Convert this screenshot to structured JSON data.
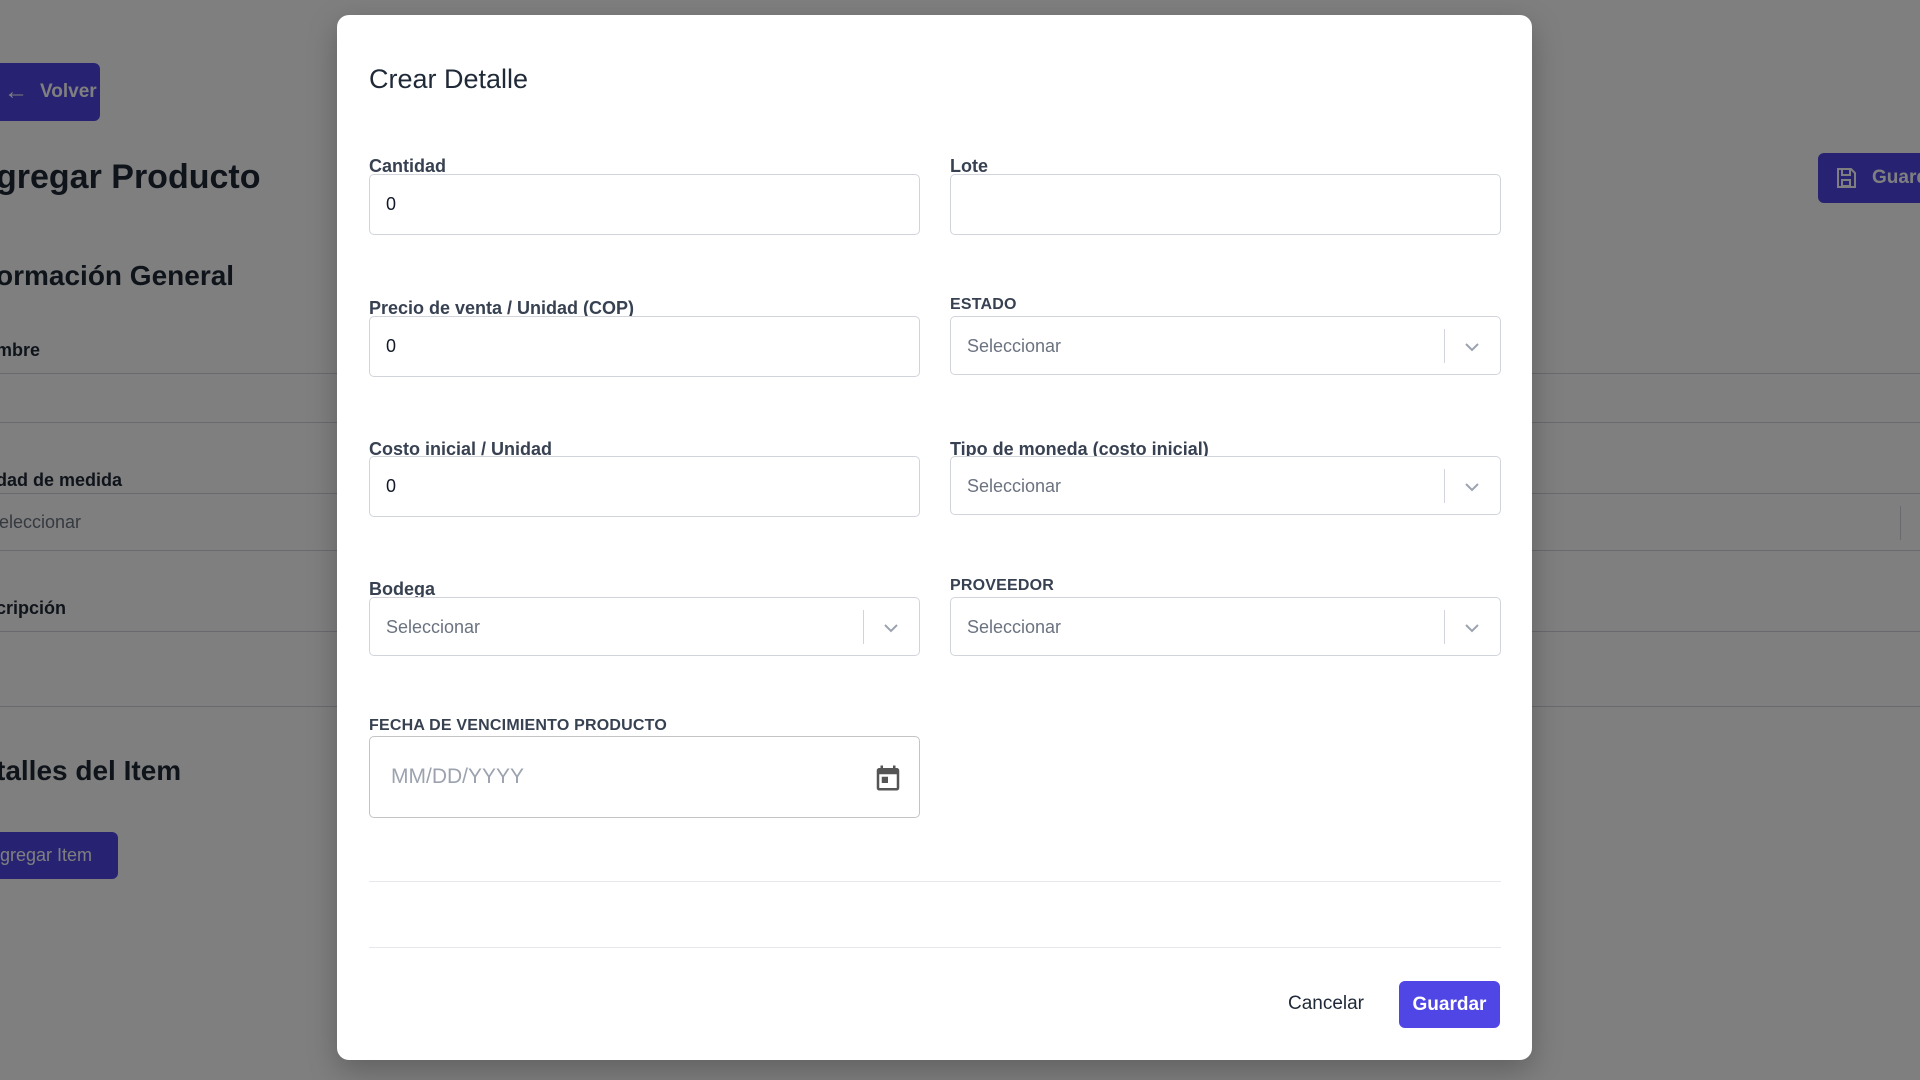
{
  "background": {
    "back_label": "Volver",
    "page_title": "gregar Producto",
    "save_label": "Guard",
    "general_section": "ormación General",
    "name_label": "mbre",
    "unit_label": "dad de medida",
    "unit_placeholder": "eleccionar",
    "description_label": "cripción",
    "details_section": "talles del Item",
    "add_item_label": "gregar Item"
  },
  "modal": {
    "title": "Crear Detalle",
    "fields": {
      "cantidad": {
        "label": "Cantidad",
        "value": "0"
      },
      "lote": {
        "label": "Lote",
        "value": ""
      },
      "precio": {
        "label": "Precio de venta / Unidad (COP)",
        "value": "0"
      },
      "estado": {
        "label": "ESTADO",
        "placeholder": "Seleccionar"
      },
      "costo": {
        "label": "Costo inicial / Unidad",
        "value": "0"
      },
      "moneda": {
        "label": "Tipo de moneda (costo inicial)",
        "placeholder": "Seleccionar"
      },
      "bodega": {
        "label": "Bodega",
        "placeholder": "Seleccionar"
      },
      "proveedor": {
        "label": "PROVEEDOR",
        "placeholder": "Seleccionar"
      },
      "fecha": {
        "label": "FECHA DE VENCIMIENTO PRODUCTO",
        "placeholder": "MM/DD/YYYY"
      }
    },
    "cancel_label": "Cancelar",
    "save_label": "Guardar"
  },
  "colors": {
    "accent": "#4f46e5",
    "overlay": "rgba(0,0,0,0.5)"
  },
  "icons": {
    "back": "arrow-left-icon",
    "save": "floppy-disk-icon",
    "select": "chevron-down-icon",
    "date": "calendar-icon"
  }
}
